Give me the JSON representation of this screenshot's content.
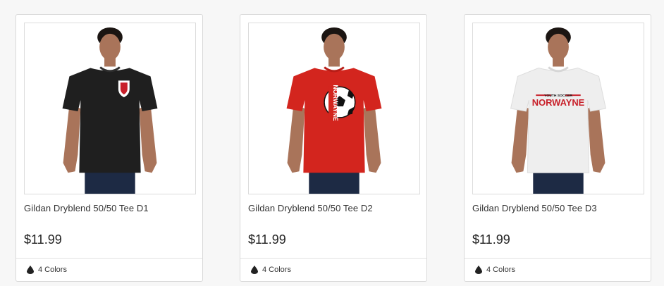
{
  "products": [
    {
      "title": "Gildan Dryblend 50/50 Tee D1",
      "price": "$11.99",
      "colors": "4 Colors",
      "shirt_color": "#1f1f1f",
      "design": "shield-logo"
    },
    {
      "title": "Gildan Dryblend 50/50 Tee D2",
      "price": "$11.99",
      "colors": "4 Colors",
      "shirt_color": "#d3251e",
      "design": "NORWAYNE soccer ball",
      "design_text": "NORWAYNE"
    },
    {
      "title": "Gildan Dryblend 50/50 Tee D3",
      "price": "$11.99",
      "colors": "4 Colors",
      "shirt_color": "#eeeeee",
      "design": "NORWAYNE YOUTH SOCCER",
      "design_text": "NORWAYNE",
      "design_subtext": "YOUTH SOCCER"
    }
  ],
  "icons": {
    "color_count": "water-drop-icon"
  }
}
